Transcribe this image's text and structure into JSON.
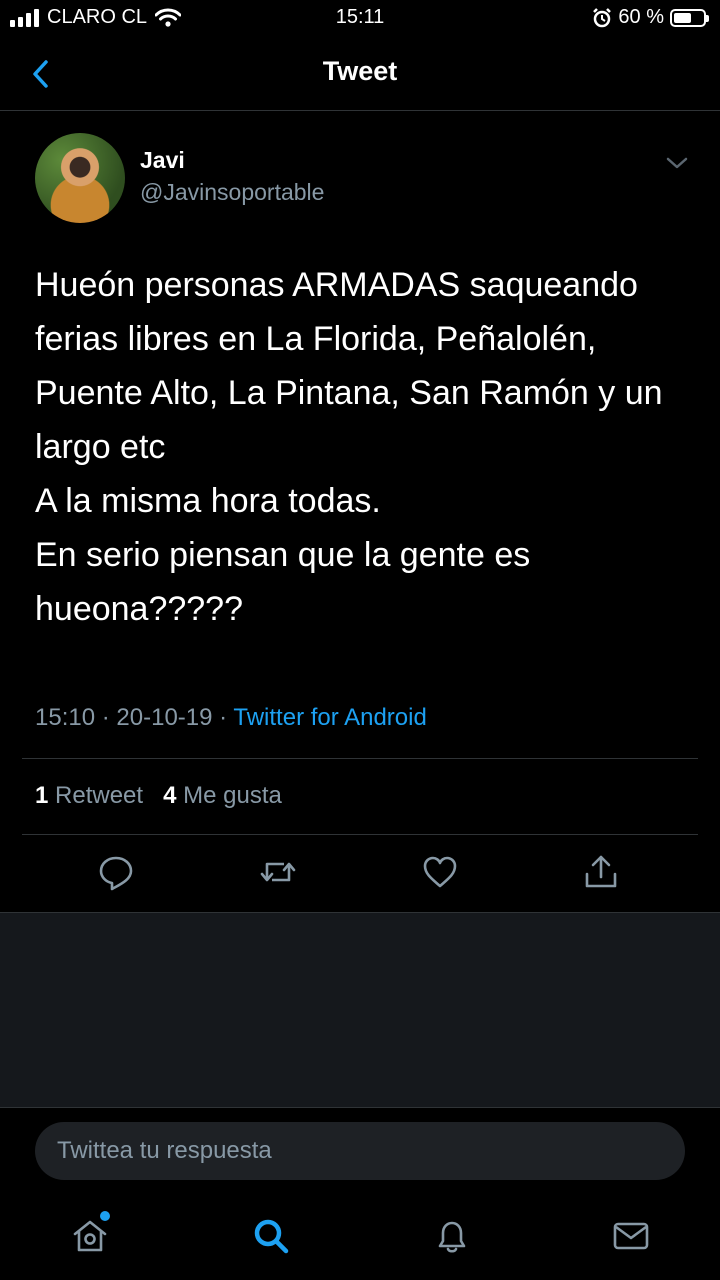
{
  "status_bar": {
    "carrier": "CLARO CL",
    "time": "15:11",
    "battery_percent": "60 %",
    "battery_level": 0.6
  },
  "header": {
    "title": "Tweet",
    "back_icon": "chevron-left-icon"
  },
  "tweet": {
    "author_name": "Javi",
    "author_handle": "@Javinsoportable",
    "text_lines": [
      "Hueón personas ARMADAS saqueando",
      "ferias libres en La Florida, Peñalolén,",
      "Puente Alto, La Pintana, San Ramón y un",
      "largo etc",
      "A la misma hora todas.",
      "En serio piensan que la gente es",
      "hueona?????"
    ],
    "time": "15:10",
    "date": "20-10-19",
    "separator": "·",
    "source": "Twitter for Android",
    "retweet_count": "1",
    "retweet_label": "Retweet",
    "like_count": "4",
    "like_label": "Me gusta"
  },
  "actions": [
    "reply-icon",
    "retweet-icon",
    "heart-icon",
    "share-icon"
  ],
  "reply": {
    "placeholder": "Twittea tu respuesta"
  },
  "tabs": [
    "home-icon",
    "search-icon",
    "notifications-icon",
    "messages-icon"
  ],
  "colors": {
    "accent": "#1da1f2",
    "secondary_text": "#8899a6",
    "background": "#000000",
    "divider": "#2f3336"
  }
}
